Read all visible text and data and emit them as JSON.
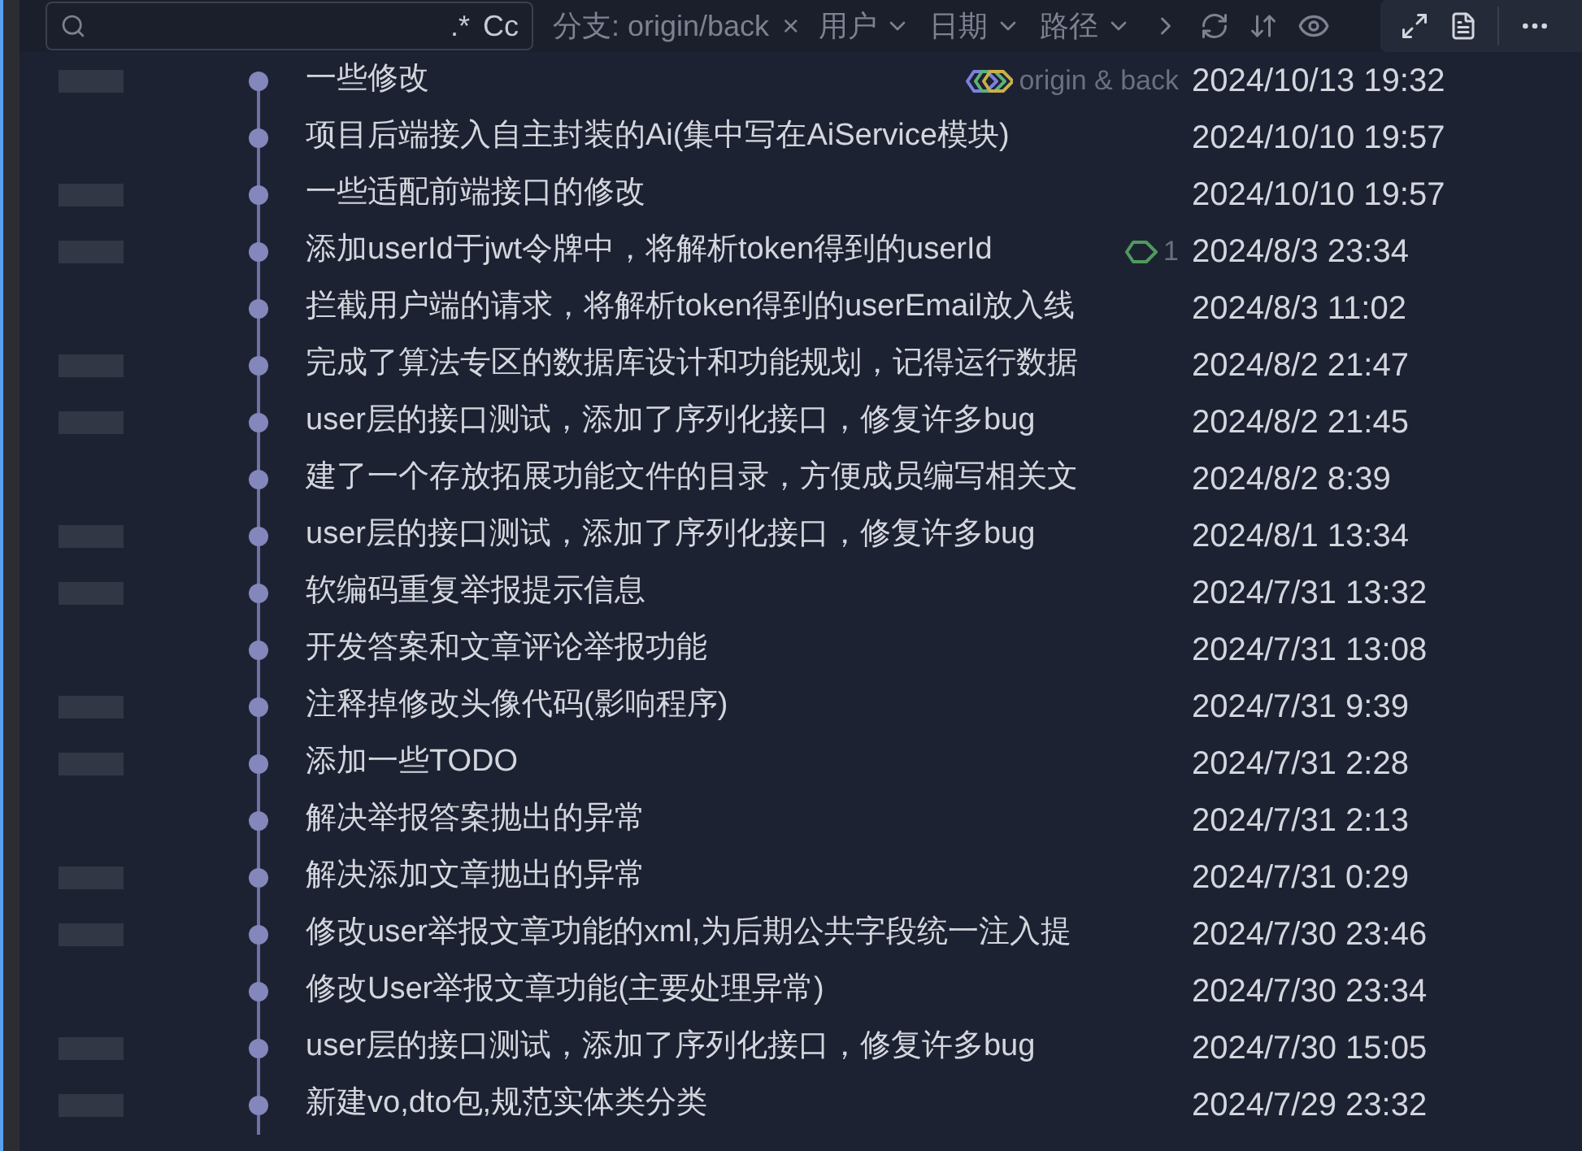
{
  "toolbar": {
    "search_options": [
      ".*",
      "Cc"
    ],
    "branch_filter": {
      "label": "分支: origin/back",
      "clear": "×"
    },
    "filters": [
      "用户",
      "日期",
      "路径"
    ]
  },
  "commits": [
    {
      "message": "一些修改",
      "date": "2024/10/13 19:32",
      "tags": [
        {
          "kind": "multi",
          "label": "origin & back"
        }
      ]
    },
    {
      "message": "项目后端接入自主封装的Ai(集中写在AiService模块)",
      "date": "2024/10/10 19:57"
    },
    {
      "message": "一些适配前端接口的修改",
      "date": "2024/10/10 19:57"
    },
    {
      "message": "添加userId于jwt令牌中，将解析token得到的userId",
      "date": "2024/8/3 23:34",
      "tags": [
        {
          "kind": "single",
          "label": "1"
        }
      ]
    },
    {
      "message": "拦截用户端的请求，将解析token得到的userEmail放入线",
      "date": "2024/8/3 11:02"
    },
    {
      "message": "完成了算法专区的数据库设计和功能规划，记得运行数据",
      "date": "2024/8/2 21:47"
    },
    {
      "message": "user层的接口测试，添加了序列化接口，修复许多bug",
      "date": "2024/8/2 21:45"
    },
    {
      "message": "建了一个存放拓展功能文件的目录，方便成员编写相关文",
      "date": "2024/8/2 8:39"
    },
    {
      "message": "user层的接口测试，添加了序列化接口，修复许多bug",
      "date": "2024/8/1 13:34"
    },
    {
      "message": "软编码重复举报提示信息",
      "date": "2024/7/31 13:32"
    },
    {
      "message": "开发答案和文章评论举报功能",
      "date": "2024/7/31 13:08"
    },
    {
      "message": "注释掉修改头像代码(影响程序)",
      "date": "2024/7/31 9:39"
    },
    {
      "message": "添加一些TODO",
      "date": "2024/7/31 2:28"
    },
    {
      "message": "解决举报答案抛出的异常",
      "date": "2024/7/31 2:13"
    },
    {
      "message": "解决添加文章抛出的异常",
      "date": "2024/7/31 0:29"
    },
    {
      "message": "修改user举报文章功能的xml,为后期公共字段统一注入提",
      "date": "2024/7/30 23:46"
    },
    {
      "message": "修改User举报文章功能(主要处理异常)",
      "date": "2024/7/30 23:34"
    },
    {
      "message": "user层的接口测试，添加了序列化接口，修复许多bug",
      "date": "2024/7/30 15:05"
    },
    {
      "message": "新建vo,dto包,规范实体类分类",
      "date": "2024/7/29 23:32"
    }
  ]
}
